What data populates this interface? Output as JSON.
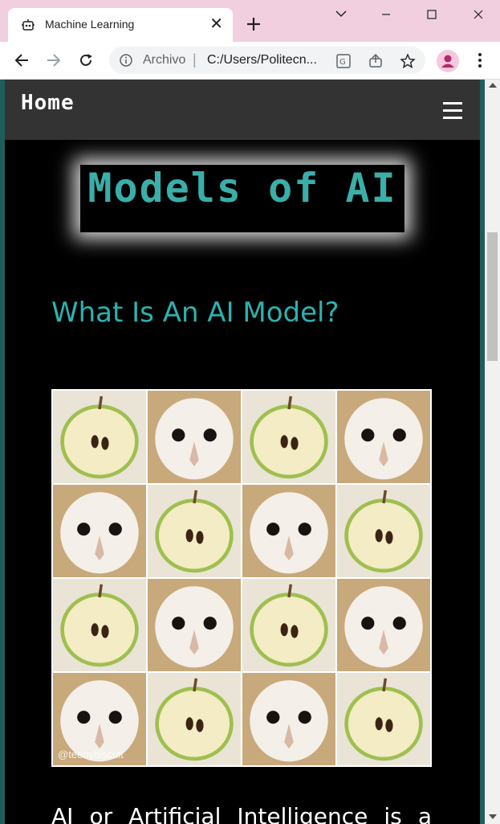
{
  "browser": {
    "tab_title": "Machine Learning",
    "tab_close": "✕",
    "new_tab": "+",
    "scheme_label": "Archivo",
    "separator": "|",
    "url": "C:/Users/Politecn..."
  },
  "page": {
    "nav_brand": "Home",
    "logo_text": "Models of AI",
    "heading": "What Is An AI Model?",
    "image_watermark": "@teenybiscuit",
    "paragraph_start": "AI or Artificial Intelligence is a"
  },
  "image_grid": {
    "cells": [
      "apple",
      "owl",
      "apple",
      "owl",
      "owl",
      "apple",
      "owl",
      "apple",
      "apple",
      "owl",
      "apple",
      "owl",
      "owl",
      "apple",
      "owl",
      "apple"
    ]
  },
  "colors": {
    "tab_strip": "#f1cfdf",
    "accent_teal": "#2bb3b0",
    "navbar": "#333333",
    "page_bg": "#000000"
  }
}
